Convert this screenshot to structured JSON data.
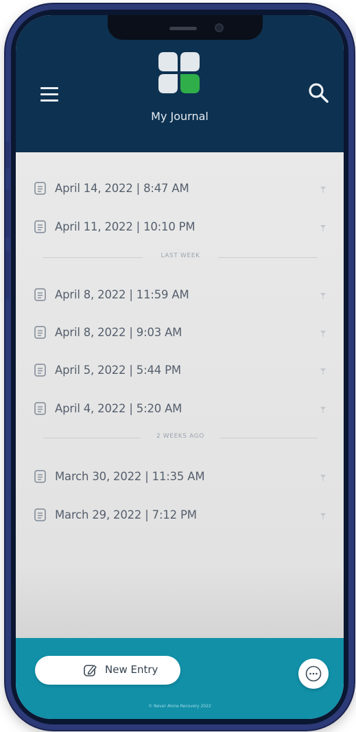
{
  "header": {
    "title": "My Journal"
  },
  "entries_recent": [
    {
      "label": "April 14, 2022 | 8:47 AM"
    },
    {
      "label": "April 11, 2022 | 10:10 PM"
    }
  ],
  "section_last_week": {
    "label": "LAST WEEK"
  },
  "entries_last_week": [
    {
      "label": "April 8, 2022 | 11:59 AM"
    },
    {
      "label": "April 8, 2022 | 9:03 AM"
    },
    {
      "label": "April 5, 2022 | 5:44 PM"
    },
    {
      "label": "April 4, 2022 | 5:20 AM"
    }
  ],
  "section_two_weeks": {
    "label": "2 WEEKS AGO"
  },
  "entries_two_weeks": [
    {
      "label": "March 30, 2022 | 11:35 AM"
    },
    {
      "label": "March 29, 2022 | 7:12 PM"
    }
  ],
  "footer": {
    "new_entry_label": "New Entry",
    "copyright": "© Never Alone Recovery 2022"
  },
  "colors": {
    "header_bg": "#0d3150",
    "footer_bg": "#1190a8",
    "logo_accent": "#2fae4a",
    "phone_frame": "#2c3a78"
  },
  "icons": {
    "menu": "hamburger-icon",
    "search": "search-icon",
    "entry": "document-icon",
    "chevron": "chevron-down-icon",
    "new_entry": "pen-icon",
    "chat": "chat-bubble-icon"
  }
}
